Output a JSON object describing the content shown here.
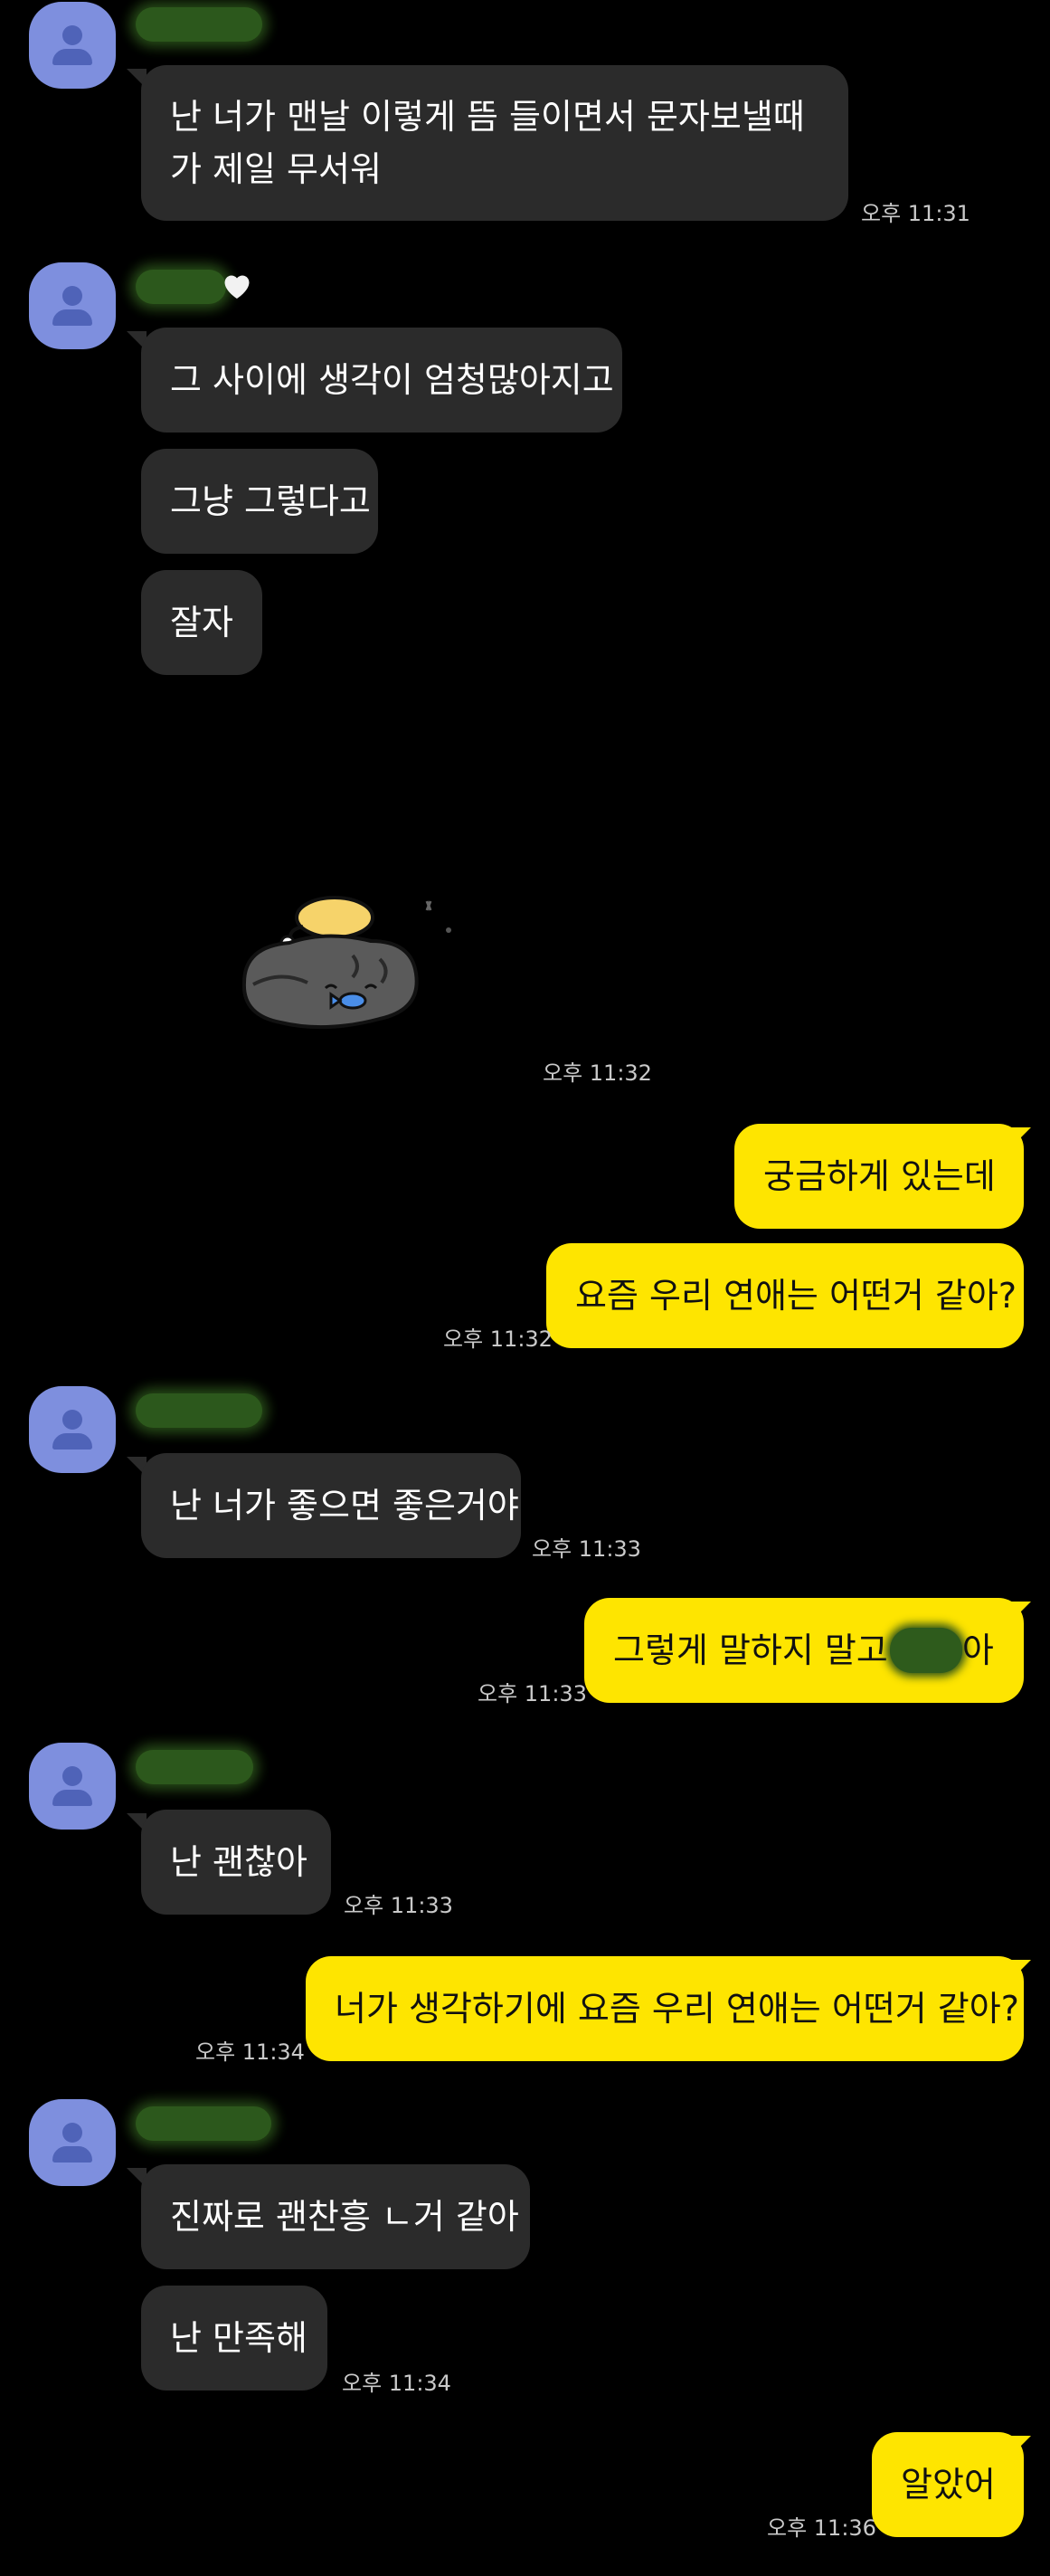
{
  "messages": {
    "m1": {
      "text": "난 너가 맨날 이렇게 뜸 들이면서 문자보낼때가 제일 무서워",
      "time": "오후 11:31"
    },
    "m2": {
      "text": "그 사이에 생각이 엄청많아지고"
    },
    "m3": {
      "text": "그냥 그렇다고"
    },
    "m4": {
      "text": "잘자"
    },
    "sticker": {
      "time": "오후 11:32",
      "icon": "sleeping-cat-sticker"
    },
    "m5": {
      "text": "궁금하게 있는데"
    },
    "m6": {
      "text": "요즘 우리 연애는 어떤거 같아?",
      "time": "오후 11:32"
    },
    "m7": {
      "text": "난 너가 좋으면 좋은거야",
      "time": "오후 11:33"
    },
    "m8": {
      "text_before": "그렇게 말하지 말고",
      "text_after": "아",
      "time": "오후 11:33"
    },
    "m9": {
      "text": "난 괜찮아",
      "time": "오후 11:33"
    },
    "m10": {
      "text": "너가 생각하기에 요즘 우리 연애는 어떤거 같아?",
      "time": "오후 11:34"
    },
    "m11": {
      "text": "진짜로 괜찬흥 ㄴ거 같아"
    },
    "m12": {
      "text": "난 만족해",
      "time": "오후 11:34"
    },
    "m13": {
      "text": "알았어",
      "time": "오후 11:36"
    }
  },
  "colors": {
    "background": "#000000",
    "incoming_bubble": "#2b2b2b",
    "outgoing_bubble": "#fee500",
    "avatar": "#7e8fde",
    "censor_blob": "#2f5d1e"
  },
  "icons": {
    "avatar": "default-profile-icon",
    "heart": "white-heart-icon"
  }
}
